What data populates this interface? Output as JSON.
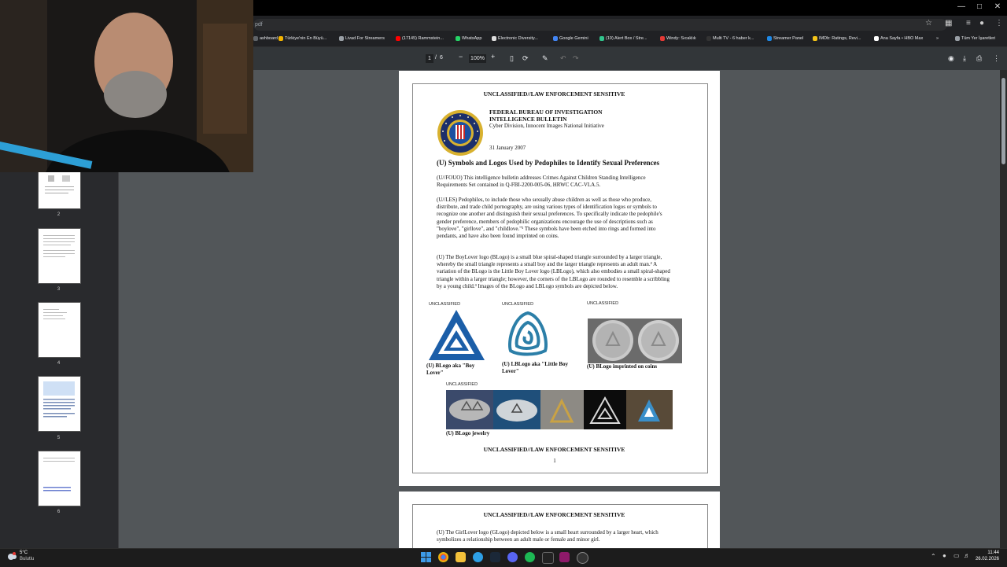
{
  "browser": {
    "address_text": "pdf",
    "bookmarks": [
      {
        "label": "ashboard",
        "color": "#5f6368"
      },
      {
        "label": "Türkiye'nin En Büyü...",
        "color": "#f4b400"
      },
      {
        "label": "Livad For Streamers",
        "color": "#9aa0a6"
      },
      {
        "label": "(17145) Rammstein...",
        "color": "#ff0000"
      },
      {
        "label": "WhatsApp",
        "color": "#25d366"
      },
      {
        "label": "Electronic Diversity...",
        "color": "#dddddd"
      },
      {
        "label": "Google Gemini",
        "color": "#4285f4"
      },
      {
        "label": "(19) Alert Box / Stre...",
        "color": "#31c48d"
      },
      {
        "label": "Windy: Sıcaklık",
        "color": "#e53935"
      },
      {
        "label": "Multi TV - 6 haber k...",
        "color": "#333333"
      },
      {
        "label": "Streamer Panel",
        "color": "#1e88e5"
      },
      {
        "label": "IMDb: Ratings, Revi...",
        "color": "#f5c518"
      },
      {
        "label": "Ana Sayfa • HBO Max",
        "color": "#ffffff"
      }
    ],
    "more_chevron": "»",
    "all_bookmarks": "Tüm Yer İşaretleri"
  },
  "toolbar": {
    "page_current": "1",
    "page_sep": "/",
    "page_total": "6",
    "zoom_minus": "−",
    "zoom": "100%",
    "zoom_plus": "+"
  },
  "thumbnails": [
    {
      "num": "2"
    },
    {
      "num": "3"
    },
    {
      "num": "4"
    },
    {
      "num": "5"
    },
    {
      "num": "6"
    }
  ],
  "doc": {
    "marking": "UNCLASSIFIED//LAW ENFORCEMENT SENSITIVE",
    "org1": "FEDERAL BUREAU OF INVESTIGATION",
    "org2": "INTELLIGENCE BULLETIN",
    "division": "Cyber Division, Innocent Images National Initiative",
    "date": "31 January 2007",
    "title": "(U) Symbols and Logos Used by Pedophiles to Identify Sexual Preferences",
    "para1": "(U//FOUO) This intelligence bulletin addresses Crimes Against Children Standing Intelligence Requirements Set contained in Q-FBI-2200-005-06, HRWC CAC-VLA.5.",
    "para2": "(U//LES) Pedophiles, to include those who sexually abuse children as well as those who produce, distribute, and trade child pornography, are using various types of identification logos or symbols to recognize one another and distinguish their sexual preferences. To specifically indicate the pedophile's gender preference, members of pedophilic organizations encourage the use of descriptions such as \"boylove\", \"girllove\", and \"childlove.\"¹ These symbols have been etched into rings and formed into pendants, and have also been found imprinted on coins.",
    "para3": "(U) The BoyLover logo (BLogo) is a small blue spiral-shaped triangle surrounded by a larger triangle, whereby the small triangle represents a small boy and the larger triangle represents an adult man.² A variation of the BLogo is the Little Boy Lover logo (LBLogo), which also embodies a small spiral-shaped triangle within a larger triangle; however, the corners of the LBLogo are rounded to resemble a scribbling by a young child.³ Images of the BLogo and LBLogo symbols are depicted below.",
    "img_label": "UNCLASSIFIED",
    "cap1": "(U) BLogo aka \"Boy Lover\"",
    "cap2": "(U) LBLogo aka \"Little Boy Lover\"",
    "cap3": "(U) BLogo imprinted on coins",
    "cap4": "(U) BLogo jewelry",
    "page_number": "1",
    "page2_para": "(U) The GirlLover logo (GLogo) depicted below is a small heart surrounded by a larger heart, which symbolizes a relationship between an adult male or female and minor girl."
  },
  "taskbar": {
    "weather_temp": "5°C",
    "weather_desc": "Bulutlu",
    "time": "11:44",
    "date": "26.02.2026"
  }
}
